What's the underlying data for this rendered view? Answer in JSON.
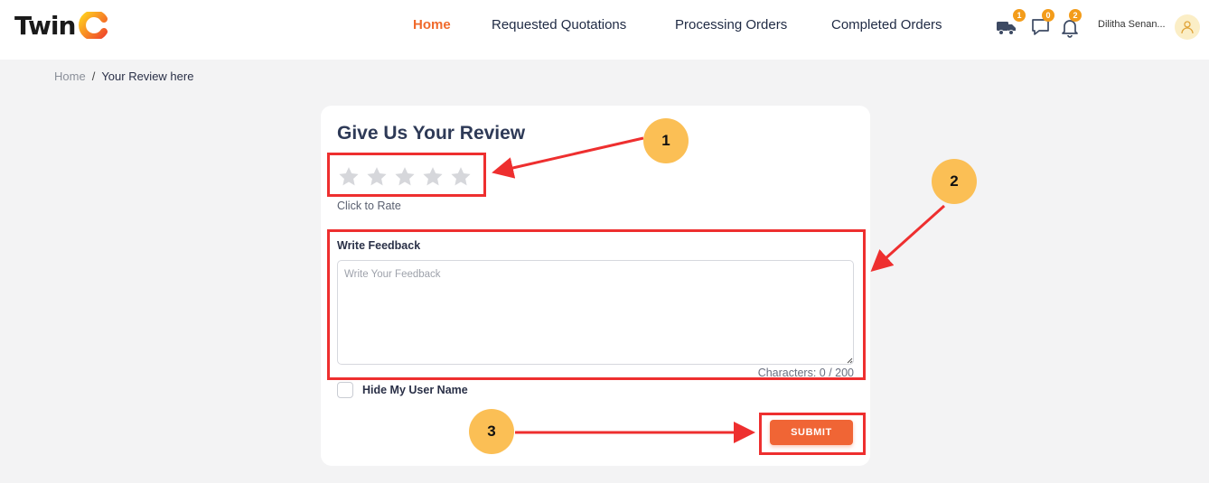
{
  "header": {
    "logo_text": "Twin",
    "nav": [
      {
        "label": "Home",
        "active": true
      },
      {
        "label": "Requested Quotations",
        "active": false
      },
      {
        "label": "Processing Orders",
        "active": false
      },
      {
        "label": "Completed Orders",
        "active": false
      }
    ],
    "icons": [
      {
        "name": "truck-icon",
        "badge": "1"
      },
      {
        "name": "chat-icon",
        "badge": "0"
      },
      {
        "name": "bell-icon",
        "badge": "2"
      }
    ],
    "user_name": "Dilitha Senan...",
    "accent_color": "#f06a2c"
  },
  "breadcrumb": {
    "home": "Home",
    "separator": "/",
    "current": "Your Review here"
  },
  "review": {
    "title": "Give Us Your Review",
    "rating": 0,
    "max_rating": 5,
    "rate_hint": "Click to Rate",
    "feedback_label": "Write Feedback",
    "feedback_placeholder": "Write Your Feedback",
    "feedback_value": "",
    "char_count": "Characters: 0 / 200",
    "hide_username_label": "Hide My User Name",
    "hide_username_checked": false,
    "submit_label": "SUBMIT"
  },
  "annotations": [
    "1",
    "2",
    "3"
  ]
}
